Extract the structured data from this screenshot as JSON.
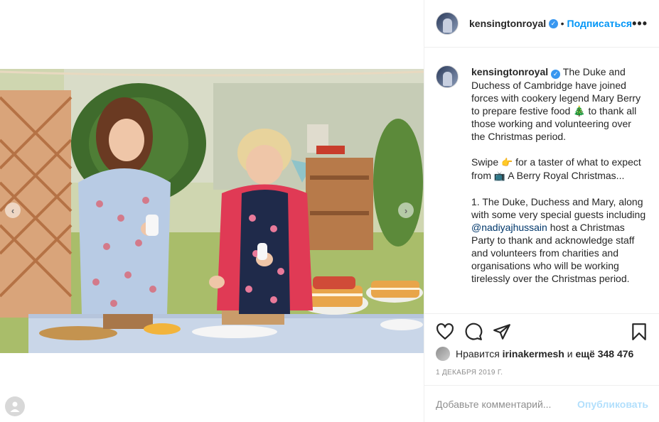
{
  "post": {
    "username": "kensingtonroyal",
    "follow_label": "Подписаться",
    "more_label": "•••",
    "caption": {
      "p1": "The Duke and Duchess of Cambridge have joined forces with cookery legend Mary Berry to prepare festive food 🎄 to thank all those working and volunteering over the Christmas period.",
      "p2_a": "Swipe ",
      "p2_emoji": "👉",
      "p2_b": " for a taster of what to expect from ",
      "p2_emoji2": "📺",
      "p2_c": " A Berry Royal Christmas...",
      "p3_a": "1. The Duke, Duchess and Mary, along with some very special guests including ",
      "p3_mention": "@nadiyajhussain",
      "p3_b": " host a Christmas Party to thank and acknowledge staff and volunteers from charities and organisations who will be working tirelessly over the Christmas period."
    },
    "likes": {
      "prefix": "Нравится",
      "user": "irinakermesh",
      "middle": "и",
      "count": "ещё 348 476"
    },
    "date": "1 ДЕКАБРЯ 2019 Г."
  },
  "comment": {
    "placeholder": "Добавьте комментарий...",
    "publish_label": "Опубликовать"
  },
  "icons": {
    "verified": "verified-badge-icon",
    "like": "heart-icon",
    "comment": "comment-icon",
    "share": "share-icon",
    "save": "bookmark-icon",
    "prev": "chevron-left-icon",
    "next": "chevron-right-icon"
  },
  "colors": {
    "accent": "#0095f6",
    "verified": "#3897f0",
    "border": "#efefef",
    "muted": "#8e8e8e"
  }
}
